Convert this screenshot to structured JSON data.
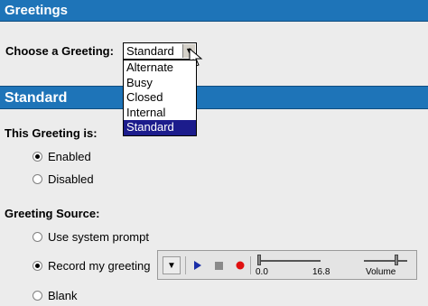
{
  "header": {
    "title": "Greetings"
  },
  "chooser": {
    "label": "Choose a Greeting:",
    "selected": "Standard",
    "options": [
      "Alternate",
      "Busy",
      "Closed",
      "Internal",
      "Standard"
    ],
    "highlighted_option": "Standard"
  },
  "section": {
    "title": "Standard"
  },
  "status": {
    "label": "This Greeting is:",
    "options": [
      {
        "label": "Enabled",
        "checked": true
      },
      {
        "label": "Disabled",
        "checked": false
      }
    ]
  },
  "source": {
    "label": "Greeting Source:",
    "options": [
      {
        "label": "Use system prompt",
        "checked": false
      },
      {
        "label": "Record my greeting",
        "checked": true
      },
      {
        "label": "Blank",
        "checked": false
      }
    ]
  },
  "player": {
    "time_start": "0.0",
    "time_end": "16.8",
    "volume_label": "Volume",
    "icons": [
      "menu-arrow-icon",
      "play-icon",
      "stop-icon",
      "record-icon"
    ],
    "colors": {
      "play": "#1a2ea8",
      "stop": "#8a8a8a",
      "record": "#e01010"
    }
  },
  "colors": {
    "banner": "#1e74b8",
    "background": "#ececec",
    "selection": "#1c1c8c"
  }
}
